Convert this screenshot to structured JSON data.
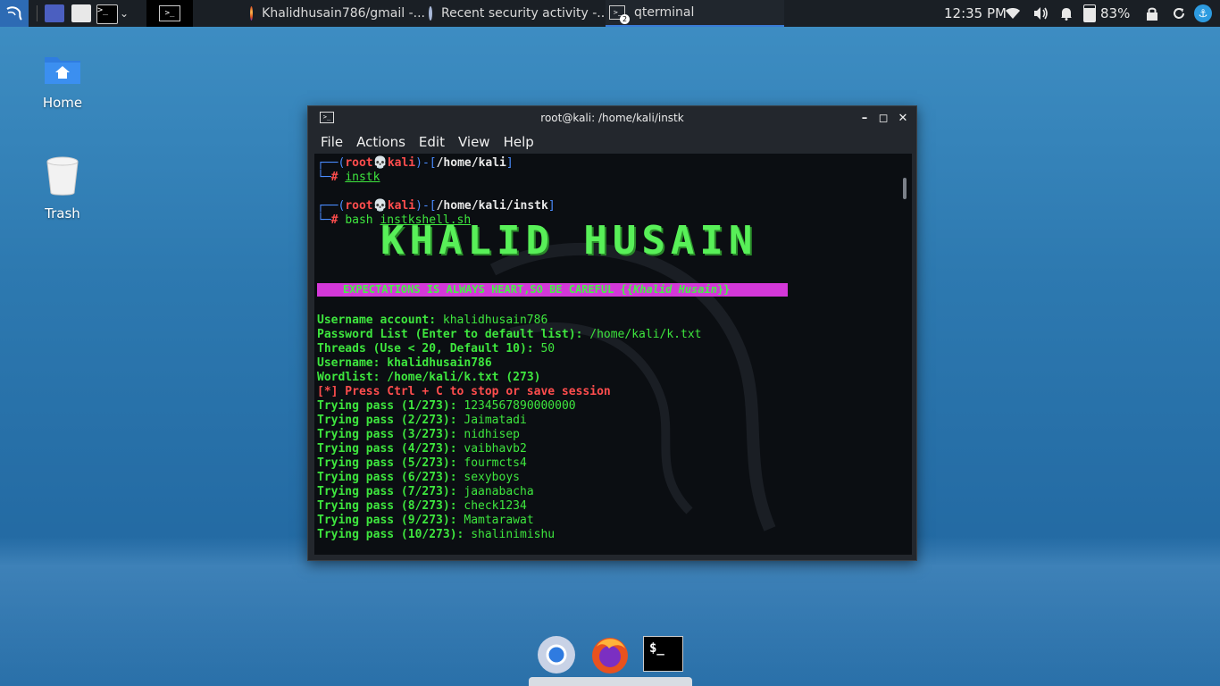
{
  "panel": {
    "tasks": [
      {
        "label": "Khalidhusain786/gmail -...",
        "icon": "firefox-icon"
      },
      {
        "label": "Recent security activity -...",
        "icon": "chrome-icon"
      },
      {
        "label": "qterminal",
        "icon": "terminal-icon",
        "badge": "2"
      }
    ],
    "clock": "12:35 PM",
    "battery": "83%"
  },
  "desktop": {
    "icons": [
      {
        "label": "Home"
      },
      {
        "label": "Trash"
      }
    ]
  },
  "window": {
    "title": "root@kali: /home/kali/instk",
    "menu": [
      "File",
      "Actions",
      "Edit",
      "View",
      "Help"
    ]
  },
  "terminal": {
    "prompt1": {
      "user": "root",
      "host": "kali",
      "path": "/home/kali",
      "cmd": "instk"
    },
    "prompt2": {
      "user": "root",
      "host": "kali",
      "path": "/home/kali/instk",
      "cmd_prefix": "bash",
      "cmd": "instkshell.sh"
    },
    "banner_art": "KHALID HUSAIN",
    "banner_line": "    EXPECTATIONS IS ALWAYS HEART,SO BE CAREFUL {{",
    "banner_line_name": "Khalid Husain",
    "banner_line_end": "}}",
    "lines": [
      {
        "label": "Username account:",
        "value": "khalidhusain786"
      },
      {
        "label": "Password List (Enter to default list):",
        "value": "/home/kali/k.txt"
      },
      {
        "label": "Threads (Use < 20, Default 10):",
        "value": "50"
      },
      {
        "label": "Username:",
        "value": "khalidhusain786",
        "bold_value": true
      },
      {
        "label": "Wordlist:",
        "value": "/home/kali/k.txt (273)",
        "bold_value": true
      }
    ],
    "warning": "[*] Press Ctrl + C to stop or save session",
    "attempts": [
      {
        "label": "Trying pass (1/273):",
        "value": "1234567890000000"
      },
      {
        "label": "Trying pass (2/273):",
        "value": "Jaimatadi"
      },
      {
        "label": "Trying pass (3/273):",
        "value": "nidhisep"
      },
      {
        "label": "Trying pass (4/273):",
        "value": "vaibhavb2"
      },
      {
        "label": "Trying pass (5/273):",
        "value": "fourmcts4"
      },
      {
        "label": "Trying pass (6/273):",
        "value": "sexyboys"
      },
      {
        "label": "Trying pass (7/273):",
        "value": "jaanabacha"
      },
      {
        "label": "Trying pass (8/273):",
        "value": "check1234"
      },
      {
        "label": "Trying pass (9/273):",
        "value": "Mamtarawat"
      },
      {
        "label": "Trying pass (10/273):",
        "value": "shalinimishu"
      }
    ]
  },
  "colors": {
    "accent": "#2d6bb4",
    "term_green": "#3ee63e",
    "term_red": "#ff4d4d",
    "banner_magenta": "#d438d8"
  }
}
